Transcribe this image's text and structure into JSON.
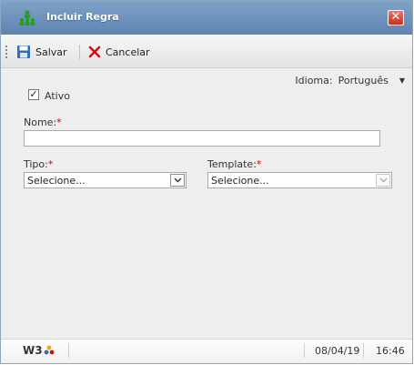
{
  "window": {
    "title": "Incluir Regra"
  },
  "toolbar": {
    "save_label": "Salvar",
    "cancel_label": "Cancelar"
  },
  "language": {
    "label": "Idioma:",
    "value": "Português"
  },
  "form": {
    "ativo": {
      "label": "Ativo",
      "checked": true
    },
    "nome": {
      "label": "Nome:",
      "required_mark": "*",
      "value": ""
    },
    "tipo": {
      "label": "Tipo:",
      "required_mark": "*",
      "selected": "Selecione..."
    },
    "template": {
      "label": "Template:",
      "required_mark": "*",
      "selected": "Selecione..."
    }
  },
  "statusbar": {
    "logo_text": "W3",
    "date": "08/04/19",
    "time": "16:46"
  },
  "colors": {
    "titlebar": "#6a8fba",
    "required": "#d20000",
    "cancel_icon": "#d01010"
  }
}
